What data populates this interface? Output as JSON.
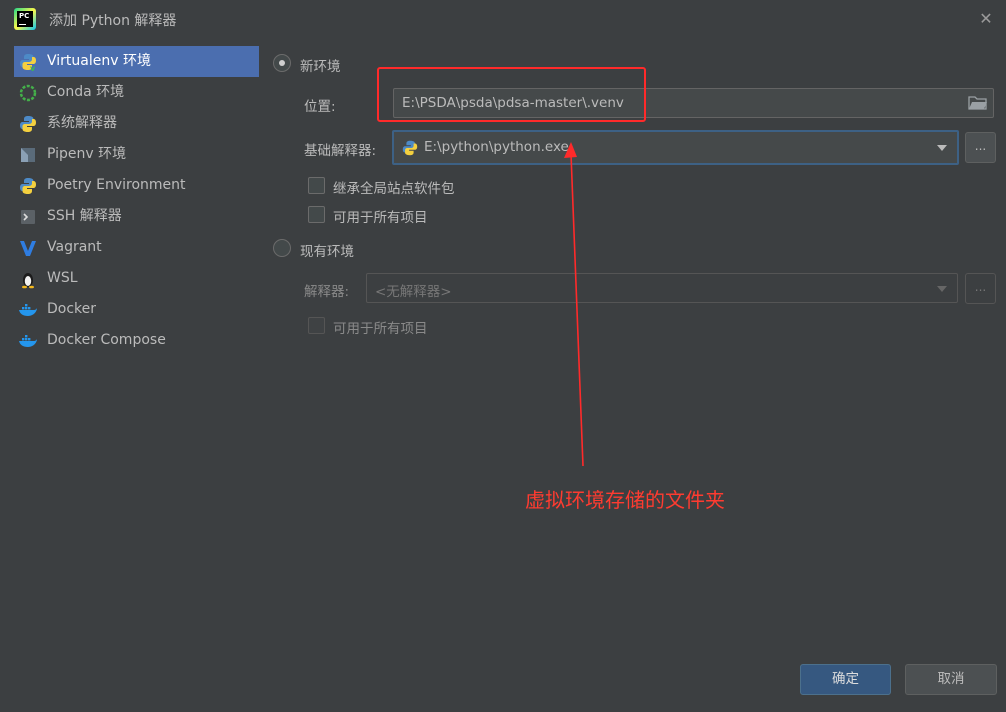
{
  "window": {
    "title": "添加 Python 解释器",
    "app_icon_text": "PC"
  },
  "sidebar": {
    "items": [
      {
        "label": "Virtualenv 环境",
        "icon": "virtualenv-icon",
        "active": true
      },
      {
        "label": "Conda 环境",
        "icon": "conda-icon"
      },
      {
        "label": "系统解释器",
        "icon": "python-icon"
      },
      {
        "label": "Pipenv 环境",
        "icon": "pipenv-icon"
      },
      {
        "label": "Poetry Environment",
        "icon": "poetry-icon"
      },
      {
        "label": "SSH 解释器",
        "icon": "ssh-icon"
      },
      {
        "label": "Vagrant",
        "icon": "vagrant-icon"
      },
      {
        "label": "WSL",
        "icon": "linux-tux-icon"
      },
      {
        "label": "Docker",
        "icon": "docker-icon"
      },
      {
        "label": "Docker Compose",
        "icon": "docker-compose-icon"
      }
    ]
  },
  "new_env": {
    "radio_label": "新环境",
    "selected": true,
    "location_label": "位置:",
    "location_value": "E:\\PSDA\\psda\\pdsa-master\\.venv",
    "base_interpreter_label": "基础解释器:",
    "base_interpreter_value": "E:\\python\\python.exe",
    "browse_label": "...",
    "inherit_label": "继承全局站点软件包",
    "inherit_checked": false,
    "available_all_label": "可用于所有项目",
    "available_all_checked": false
  },
  "existing_env": {
    "radio_label": "现有环境",
    "selected": false,
    "interpreter_label": "解释器:",
    "interpreter_value": "<无解释器>",
    "browse_label": "...",
    "available_all_label": "可用于所有项目"
  },
  "annotation": {
    "text": "虚拟环境存储的文件夹",
    "color": "#ff2a2a"
  },
  "footer": {
    "ok_label": "确定",
    "cancel_label": "取消"
  },
  "colors": {
    "background": "#3c3f41",
    "selection": "#4b6eaf",
    "primary_button": "#365880"
  }
}
